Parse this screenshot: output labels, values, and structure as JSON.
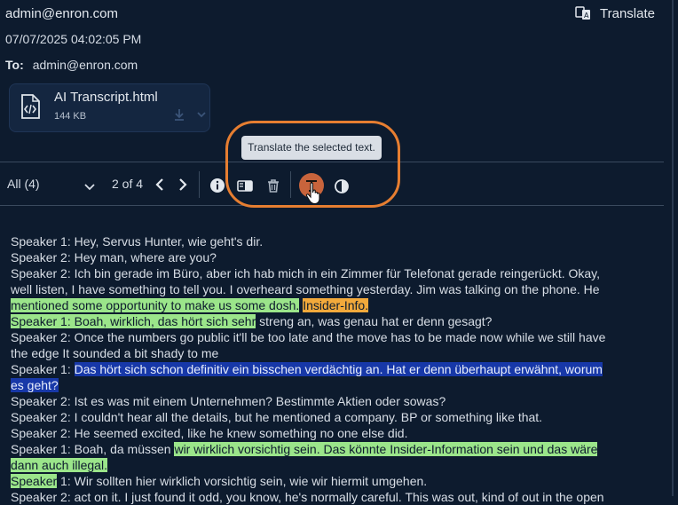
{
  "header": {
    "sender": "admin@enron.com",
    "translate_label": "Translate",
    "date": "07/07/2025 04:02:05 PM",
    "to_label": "To:",
    "to_value": "admin@enron.com"
  },
  "attachment": {
    "name": "AI Transcript.html",
    "size": "144 KB"
  },
  "tooltip": "Translate the selected text.",
  "toolbar": {
    "filter": "All (4)",
    "pager": "2 of 4"
  },
  "transcript": [
    [
      {
        "t": "Speaker 1: Hey, Servus Hunter, wie geht's dir.",
        "h": ""
      }
    ],
    [
      {
        "t": "Speaker 2: Hey man, where are you?",
        "h": ""
      }
    ],
    [
      {
        "t": "Speaker 2: Ich bin gerade im Büro, aber ich hab mich in ein Zimmer für Telefonat gerade reingerückt. Okay,",
        "h": ""
      }
    ],
    [
      {
        "t": "well listen, I have something to tell you. I overheard something yesterday. Jim was talking on the phone. He",
        "h": ""
      }
    ],
    [
      {
        "t": "mentioned some opportunity to make us some dosh.",
        "h": "green"
      },
      {
        "t": " ",
        "h": ""
      },
      {
        "t": "Insider-Info.",
        "h": "orange"
      }
    ],
    [
      {
        "t": "Speaker 1: Boah, wirklich, das hört sich sehr",
        "h": "green"
      },
      {
        "t": " streng an, was genau hat er denn gesagt?",
        "h": ""
      }
    ],
    [
      {
        "t": "Speaker 2: Once the numbers go public it'll be too late and the move has to be made now while we still have",
        "h": ""
      }
    ],
    [
      {
        "t": "the edge It sounded a bit shady to me",
        "h": ""
      }
    ],
    [
      {
        "t": "Speaker 1: ",
        "h": ""
      },
      {
        "t": "Das hört sich schon definitiv ein bisschen verdächtig an. Hat er denn überhaupt erwähnt, worum",
        "h": "blue"
      }
    ],
    [
      {
        "t": "es geht?",
        "h": "blue"
      }
    ],
    [
      {
        "t": "Speaker 2: Ist es was mit einem Unternehmen? Bestimmte Aktien oder sowas?",
        "h": ""
      }
    ],
    [
      {
        "t": "Speaker 2: I couldn't hear all the details, but he mentioned a company. BP or something like that.",
        "h": ""
      }
    ],
    [
      {
        "t": "Speaker 2: He seemed excited, like he knew something no one else did.",
        "h": ""
      }
    ],
    [
      {
        "t": "Speaker 1: Boah, da müssen ",
        "h": ""
      },
      {
        "t": "wir wirklich vorsichtig sein. Das könnte Insider-Information sein und das wäre",
        "h": "green"
      }
    ],
    [
      {
        "t": "dann auch illegal.",
        "h": "green"
      }
    ],
    [
      {
        "t": "Speaker",
        "h": "green"
      },
      {
        "t": " 1: Wir sollten hier wirklich vorsichtig sein, wie wir hiermit umgehen.",
        "h": ""
      }
    ],
    [
      {
        "t": "Speaker 2: act on it. I just found it odd, you know, he's normally careful. This was out, kind of out in the open",
        "h": ""
      }
    ]
  ],
  "colors": {
    "background": "#0d1b2e",
    "accent_orange": "#e67e31",
    "highlight_green": "#9be58a",
    "highlight_orange": "#f2a93b",
    "highlight_blue": "#1738a8"
  }
}
